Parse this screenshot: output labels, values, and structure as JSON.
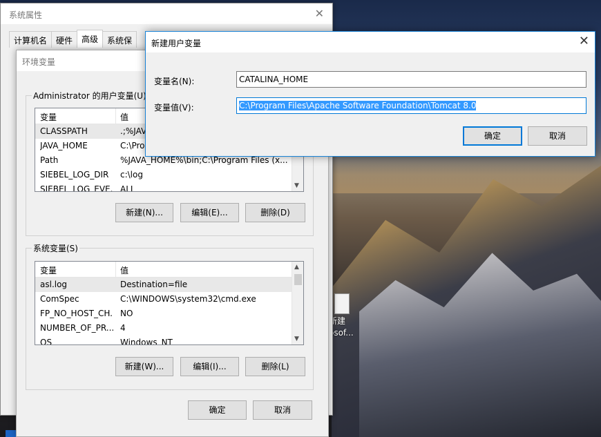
{
  "desktop": {
    "icon_label_line1": "新建",
    "icon_label_line2": "osof..."
  },
  "system_properties": {
    "title": "系统属性",
    "close_glyph": "✕",
    "tabs": [
      {
        "label": "计算机名"
      },
      {
        "label": "硬件"
      },
      {
        "label": "高级"
      },
      {
        "label": "系统保"
      }
    ]
  },
  "env_vars": {
    "title": "环境变量",
    "user_group_label": "Administrator 的用户变量(U)",
    "user_columns": {
      "name": "变量",
      "value": "值"
    },
    "user_rows": [
      {
        "name": "CLASSPATH",
        "value": ".;%JAVA"
      },
      {
        "name": "JAVA_HOME",
        "value": "C:\\Prog"
      },
      {
        "name": "Path",
        "value": "%JAVA_HOME%\\bin;C:\\Program Files (x..."
      },
      {
        "name": "SIEBEL_LOG_DIR",
        "value": "c:\\log"
      },
      {
        "name": "SIEBEL_LOG_EVE...",
        "value": "ALL"
      }
    ],
    "user_buttons": {
      "new": "新建(N)...",
      "edit": "编辑(E)...",
      "delete": "删除(D)"
    },
    "system_group_label": "系统变量(S)",
    "system_columns": {
      "name": "变量",
      "value": "值"
    },
    "system_rows": [
      {
        "name": "asl.log",
        "value": "Destination=file"
      },
      {
        "name": "ComSpec",
        "value": "C:\\WINDOWS\\system32\\cmd.exe"
      },
      {
        "name": "FP_NO_HOST_CH...",
        "value": "NO"
      },
      {
        "name": "NUMBER_OF_PR...",
        "value": "4"
      },
      {
        "name": "OS",
        "value": "Windows_NT"
      }
    ],
    "system_buttons": {
      "new": "新建(W)...",
      "edit": "编辑(I)...",
      "delete": "删除(L)"
    },
    "ok": "确定",
    "cancel": "取消"
  },
  "new_var_dialog": {
    "title": "新建用户变量",
    "close_glyph": "✕",
    "name_label": "变量名(N):",
    "name_value": "CATALINA_HOME",
    "value_label": "变量值(V):",
    "value_value": "C:\\Program Files\\Apache Software Foundation\\Tomcat 8.0",
    "ok": "确定",
    "cancel": "取消"
  },
  "colors": {
    "accent": "#0078d7",
    "selection": "#3399ff"
  }
}
